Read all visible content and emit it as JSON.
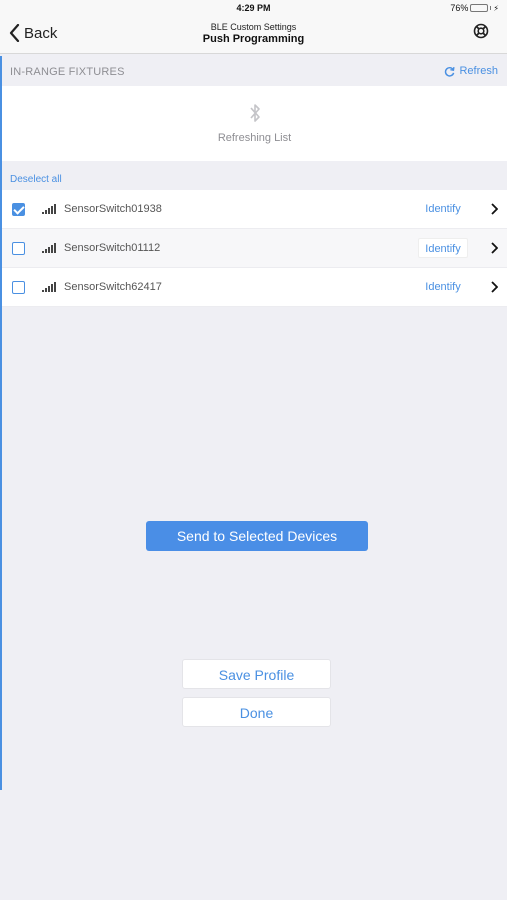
{
  "status_bar": {
    "time": "4:29 PM",
    "battery": "76%",
    "battery_level": 0.76,
    "battery_color": "#4cd964"
  },
  "nav": {
    "back_label": "Back",
    "subtitle": "BLE Custom Settings",
    "title": "Push Programming",
    "help_icon": "lifebuoy-icon"
  },
  "section": {
    "title": "IN-RANGE FIXTURES",
    "refresh_label": "Refresh"
  },
  "refresh_panel": {
    "icon": "bluetooth-icon",
    "text": "Refreshing List"
  },
  "deselect_label": "Deselect all",
  "devices": [
    {
      "name": "SensorSwitch01938",
      "checked": true,
      "identify_label": "Identify"
    },
    {
      "name": "SensorSwitch01112",
      "checked": false,
      "identify_label": "Identify"
    },
    {
      "name": "SensorSwitch62417",
      "checked": false,
      "identify_label": "Identify"
    }
  ],
  "buttons": {
    "send": "Send to Selected Devices",
    "save_profile": "Save Profile",
    "done": "Done"
  },
  "colors": {
    "accent": "#4a90e2",
    "send_button": "#4a8ee6",
    "background": "#efeff4"
  }
}
